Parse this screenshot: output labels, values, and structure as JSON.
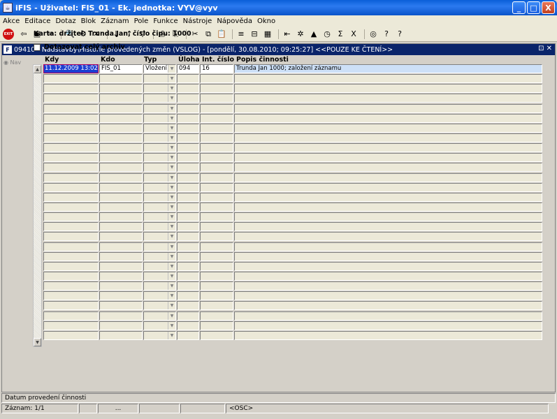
{
  "window": {
    "title": "iFIS - Uživatel: FIS_01 - Ek. jednotka: VYV@vyv",
    "min_label": "_",
    "max_label": "□",
    "close_label": "X"
  },
  "menu": [
    "Akce",
    "Editace",
    "Dotaz",
    "Blok",
    "Záznam",
    "Pole",
    "Funkce",
    "Nástroje",
    "Nápověda",
    "Okno"
  ],
  "toolbar": {
    "exit_label": "EXIT",
    "icons": [
      {
        "name": "back-icon",
        "glyph": "⇦"
      },
      {
        "name": "save-icon",
        "glyph": "▣"
      },
      {
        "name": "forward-icon",
        "glyph": "⇨"
      },
      {
        "name": "query-icon",
        "glyph": "🔍"
      },
      {
        "name": "query-run-icon",
        "glyph": "⚙"
      },
      {
        "name": "query-cancel-icon",
        "glyph": "✕"
      },
      {
        "name": "sort-asc-icon",
        "glyph": "↓"
      },
      {
        "name": "sort-desc-icon",
        "glyph": "↑"
      },
      {
        "name": "filter-icon",
        "glyph": "▽"
      },
      {
        "name": "print-icon",
        "glyph": "⎙"
      },
      {
        "name": "print-preview-icon",
        "glyph": "⎘"
      },
      {
        "name": "cut-icon",
        "glyph": "✂"
      },
      {
        "name": "copy-icon",
        "glyph": "⧉"
      },
      {
        "name": "paste-icon",
        "glyph": "📋"
      },
      {
        "name": "insert-row-icon",
        "glyph": "≡"
      },
      {
        "name": "delete-row-icon",
        "glyph": "⊟"
      },
      {
        "name": "table-icon",
        "glyph": "▦"
      },
      {
        "name": "first-record-icon",
        "glyph": "⇤"
      },
      {
        "name": "tools-icon",
        "glyph": "✲"
      },
      {
        "name": "chart-icon",
        "glyph": "▲"
      },
      {
        "name": "clock-icon",
        "glyph": "◷"
      },
      {
        "name": "sum-icon",
        "glyph": "Σ"
      },
      {
        "name": "excel-icon",
        "glyph": "X"
      },
      {
        "name": "globe-icon",
        "glyph": "◎"
      },
      {
        "name": "help-context-icon",
        "glyph": "?"
      },
      {
        "name": "help-icon",
        "glyph": "?"
      }
    ]
  },
  "form": {
    "title": "09410 - Nadstavby\\Historie provedených změn (VSLOG) - [pondělí, 30.08.2010; 09:25:27] <<POUZE KE ČTENÍ>>",
    "icon_label": "F",
    "controls": "⊡ ✕",
    "nav_label": "◉ Nav",
    "karta": "Karta: držitel: Trunda Jan, číslo čipu: 1000",
    "archive_checkbox_label": "Dotazovat celý archiv"
  },
  "table": {
    "headers": {
      "kdy": "Kdy",
      "kdo": "Kdo",
      "typ": "Typ",
      "uloha": "Úloha",
      "int": "Int. číslo",
      "popis": "Popis činnosti"
    },
    "rows": [
      {
        "kdy": "11.12.2009 13:02",
        "kdo": "FIS_01",
        "typ": "Vložení",
        "uloha": "094",
        "int": "16",
        "popis": "Trunda Jan 1000; založení záznamu"
      }
    ]
  },
  "status": {
    "hint": "Datum provedení činnosti",
    "record": "Záznam: 1/1",
    "seg3": "...",
    "osc": "<OSC>"
  }
}
